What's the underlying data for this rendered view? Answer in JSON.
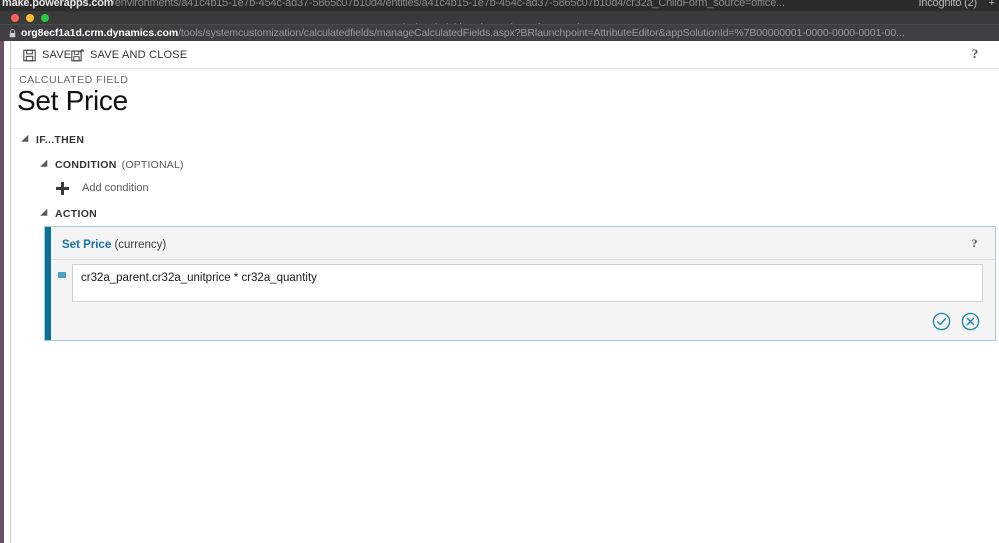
{
  "browser": {
    "tab_url_bold": "make.powerapps.com",
    "tab_url_rest": "/environments/a41c4b15-1e7b-454c-ad37-5865c07b10d4/entities/a41c4b15-1e7b-454c-ad37-5865c07b10d4/cr32a_ChildForm_source=office...",
    "incognito_label": "Incognito (2)",
    "new_tab_label": "+",
    "window_title": "Calculated Field - Price - Microsoft Dynamics 365",
    "lock_icon": "lock-icon",
    "url_domain": "org8ecf1a1d.crm.dynamics.com",
    "url_path": "/tools/systemcustomization/calculatedfields/manageCalculatedFields.aspx?BRlaunchpoint=AttributeEditor&appSolutionId=%7B00000001-0000-0000-0001-00...",
    "traffic_lights": [
      "close-red",
      "minimize-yellow",
      "maximize-green"
    ]
  },
  "toolbar": {
    "save_label": "SAVE",
    "save_icon": "floppy-disk-icon",
    "save_and_close_label": "SAVE AND CLOSE",
    "save_and_close_icon": "floppy-disk-close-icon",
    "help_label": "?"
  },
  "header": {
    "eyebrow": "CALCULATED FIELD",
    "title": "Set Price"
  },
  "tree": {
    "if_then": {
      "label": "IF...THEN",
      "caret_icon": "caret-expanded-icon"
    },
    "condition": {
      "label": "CONDITION",
      "suffix": "(OPTIONAL)",
      "caret_icon": "caret-expanded-icon"
    },
    "add_condition": {
      "label": "Add condition",
      "icon": "plus-icon"
    },
    "action": {
      "label": "ACTION",
      "caret_icon": "caret-expanded-icon"
    }
  },
  "action_panel": {
    "field_name": "Set Price",
    "field_type": "(currency)",
    "help_label": "?",
    "drag_handle_icon": "drag-handle-icon",
    "formula_value": "cr32a_parent.cr32a_unitprice * cr32a_quantity",
    "formula_placeholder": "",
    "confirm_icon": "check-circle-icon",
    "cancel_icon": "cancel-circle-icon",
    "accent_color": "#0b6f96",
    "button_color": "#1a84a8"
  }
}
